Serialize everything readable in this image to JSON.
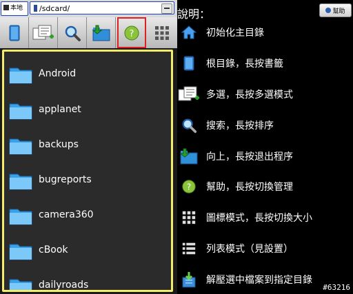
{
  "path_bar": {
    "local_label": "本地",
    "path": "/sdcard/"
  },
  "toolbar": {
    "buttons": [
      {
        "icon": "bookmark-icon"
      },
      {
        "icon": "multi-select-icon"
      },
      {
        "icon": "search-icon"
      },
      {
        "icon": "up-folder-icon"
      },
      {
        "icon": "help-icon",
        "highlighted": true
      },
      {
        "icon": "grid-view-icon"
      }
    ]
  },
  "files": [
    {
      "name": "Android"
    },
    {
      "name": "applanet"
    },
    {
      "name": "backups"
    },
    {
      "name": "bugreports"
    },
    {
      "name": "camera360"
    },
    {
      "name": "cBook"
    },
    {
      "name": "dailyroads"
    }
  ],
  "help": {
    "title": "說明：",
    "help_button": "幫助",
    "items": [
      {
        "icon": "home-icon",
        "text": "初始化主目錄"
      },
      {
        "icon": "bookmark-icon",
        "text": "根目錄，長按書籤"
      },
      {
        "icon": "multi-select-icon",
        "text": "多選，長按多選模式"
      },
      {
        "icon": "search-icon",
        "text": "搜索，長按排序"
      },
      {
        "icon": "up-folder-icon",
        "text": "向上，長按退出程序"
      },
      {
        "icon": "help-icon",
        "text": "幫助，長按切換管理"
      },
      {
        "icon": "grid-view-icon",
        "text": "圖標模式，長按切換大小"
      },
      {
        "icon": "list-view-icon",
        "text": "列表模式（見設置）"
      },
      {
        "icon": "extract-icon",
        "text": "解壓選中檔案到指定目錄"
      }
    ]
  },
  "watermark": "#63216",
  "colors": {
    "list_border": "#f5ec6a",
    "help_highlight": "#e02020",
    "path_border": "#1a3fb8",
    "folder_blue": "#3aa0e8"
  }
}
